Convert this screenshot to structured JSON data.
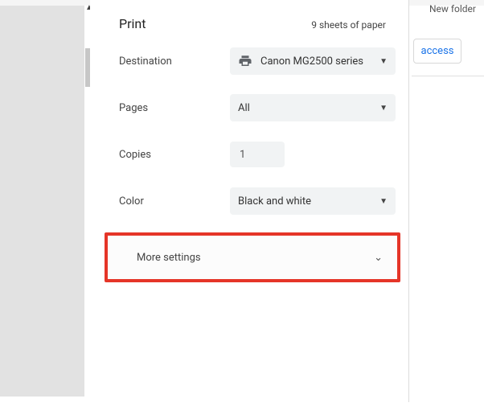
{
  "background": {
    "new_folder_label": "New folder",
    "access_button_label": "access"
  },
  "print_dialog": {
    "title": "Print",
    "sheets_text": "9 sheets of paper",
    "destination": {
      "label": "Destination",
      "selected": "Canon MG2500 series",
      "icon": "printer-icon"
    },
    "pages": {
      "label": "Pages",
      "selected": "All"
    },
    "copies": {
      "label": "Copies",
      "value": "1"
    },
    "color": {
      "label": "Color",
      "selected": "Black and white"
    },
    "more_settings_label": "More settings"
  }
}
